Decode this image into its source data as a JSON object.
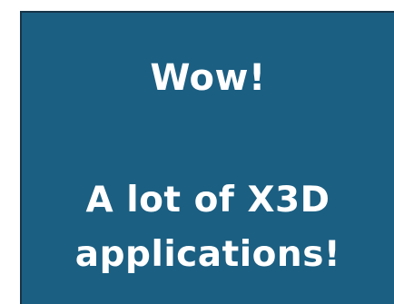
{
  "slide": {
    "headline": "Wow!",
    "message_line1": "A lot of X3D",
    "message_line2": "applications!"
  },
  "colors": {
    "background": "#1b5f82",
    "border": "#173447",
    "text": "#ffffff",
    "page": "#ffffff"
  }
}
